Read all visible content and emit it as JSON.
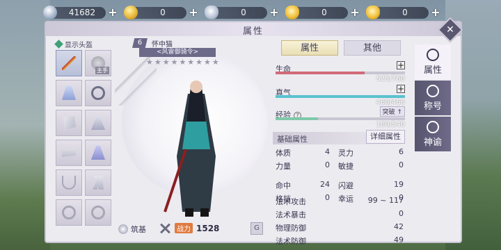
{
  "resources": [
    {
      "icon": "silver-coin-icon",
      "value": "41682"
    },
    {
      "icon": "gold-coin-icon",
      "value": "0"
    },
    {
      "icon": "silver-ingot-icon",
      "value": "0"
    },
    {
      "icon": "gold-ingot-icon",
      "value": "0"
    },
    {
      "icon": "gold-ingot-icon",
      "value": "0"
    }
  ],
  "panel": {
    "title": "属性"
  },
  "equipment": {
    "show_head_label": "显示头盔",
    "slots": [
      {
        "icon": "sword-icon"
      },
      {
        "icon": "coin-icon",
        "badge": "主手"
      },
      {
        "icon": "robe-icon"
      },
      {
        "icon": "bracelet-icon"
      },
      {
        "icon": "sash-icon"
      },
      {
        "icon": "cape-icon"
      },
      {
        "icon": "belt-icon"
      },
      {
        "icon": "dress-icon"
      },
      {
        "icon": "necklace-icon"
      },
      {
        "icon": "boots-icon"
      },
      {
        "icon": "ring-icon"
      },
      {
        "icon": "ring-icon"
      }
    ]
  },
  "character": {
    "level": "6",
    "name": "怀中猫",
    "title": "<风雷御骑令>",
    "stars": "★★★★★★★★★",
    "realm_label": "筑基",
    "power_badge": "战力",
    "power_value": "1528"
  },
  "tabs": [
    "属性",
    "其他"
  ],
  "bars": {
    "hp": {
      "label": "生命",
      "value": "525/760",
      "fraction": 0.69,
      "color": "#d06a78"
    },
    "mp": {
      "label": "真气",
      "value": "466/466",
      "fraction": 1.0,
      "color": "#59c2cf"
    },
    "exp": {
      "label": "经验",
      "value": "180/540",
      "fraction": 0.33,
      "color": "#7ec9a8",
      "button": "突破"
    }
  },
  "basic": {
    "section_label": "基础属性",
    "detail_button": "详细属性",
    "rows": [
      [
        "体质",
        "4",
        "灵力",
        "6"
      ],
      [
        "力量",
        "0",
        "敏捷",
        "0"
      ],
      [
        "命中",
        "24",
        "闪避",
        "19"
      ],
      [
        "格挡",
        "0",
        "幸运",
        "0"
      ]
    ],
    "long_rows": [
      [
        "法术攻击",
        "99 ~ 117"
      ],
      [
        "法术暴击",
        "0"
      ],
      [
        "物理防御",
        "42"
      ],
      [
        "法术防御",
        "49"
      ]
    ]
  },
  "sidenav": [
    "属性",
    "称号",
    "神谕"
  ]
}
